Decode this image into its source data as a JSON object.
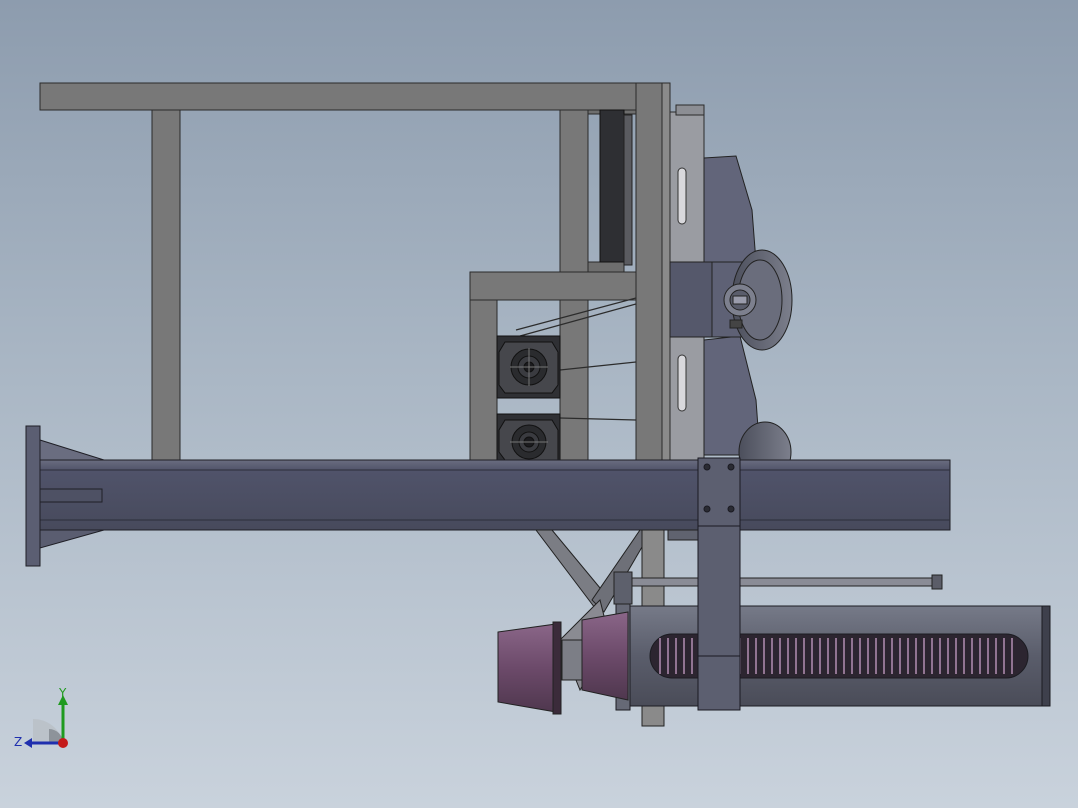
{
  "viewport": {
    "background_top": "#8d9cae",
    "background_bottom": "#c9d2dc",
    "frame_color": "#757575",
    "beam_color": "#55586a",
    "cylinder_color": "#5e6170",
    "coil_color": "#6b4f6b",
    "cone_color": "#6f4a6f"
  },
  "triad": {
    "y_label": "Y",
    "z_label": "Z",
    "y_color": "#1f9a1f",
    "z_color": "#1f2fae",
    "x_color": "#c41a1a"
  }
}
